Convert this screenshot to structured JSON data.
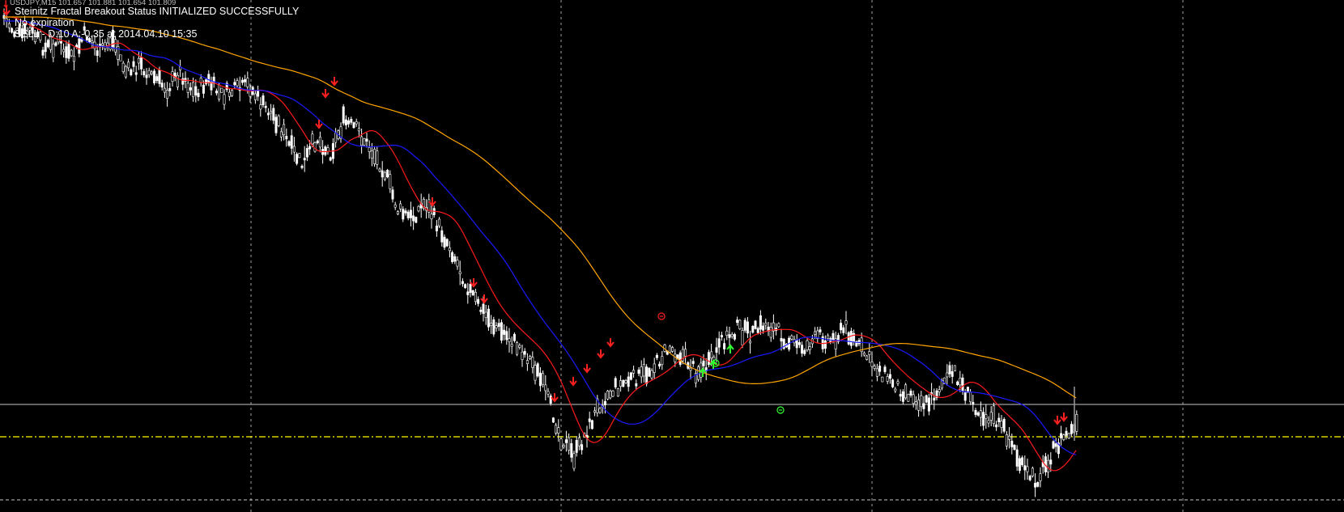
{
  "header": {
    "symbol_info": "USDJPY,M15  101.657 101.881 101.654 101.809",
    "status": "Steinitz Fractal Breakout Status INITIALIZED SUCCESSFULLY",
    "expiration": "No expiration",
    "signal": "SELL - D:10 A:-0.35 at 2014.04.10 15:35"
  },
  "icons": {
    "corner": "sell-arrow-icon",
    "sell_marker": "red-down-arrow-icon",
    "buy_marker": "green-up-arrow-icon",
    "buy_exit": "green-circle-minus-icon",
    "sell_exit": "red-circle-plus-icon"
  },
  "colors": {
    "background": "#000000",
    "candle": "#ffffff",
    "grid": "#a0a0a0",
    "fast_ma": "#ff1a1a",
    "mid_ma": "#1a1aff",
    "slow_ma": "#ffa500",
    "bid_line": "#c8c8c8",
    "level_line": "#ffff00",
    "sell_arrow": "#ff2020",
    "buy_arrow": "#32ff32"
  },
  "chart_data": {
    "type": "line",
    "note_series": "approximate price path of USDJPY M15 candles",
    "price_path": [
      1,
      25,
      18,
      40,
      32,
      55,
      20,
      45,
      28,
      70,
      60,
      75,
      90,
      68,
      95,
      80,
      98,
      92,
      85,
      110,
      125,
      160,
      185,
      150,
      170,
      130,
      140,
      165,
      190,
      240,
      250,
      230,
      260,
      290,
      330,
      360,
      380,
      395,
      410,
      430,
      470,
      520,
      545,
      510,
      475,
      460,
      450,
      445,
      430,
      410,
      420,
      440,
      430,
      400,
      385,
      395,
      380,
      390,
      405,
      410,
      395,
      400,
      385,
      410,
      430,
      445,
      460,
      470,
      480,
      455,
      440,
      470,
      490,
      500,
      520,
      560,
      575,
      545,
      520,
      510
    ],
    "bid_level": 0.5,
    "grid_on": true
  }
}
